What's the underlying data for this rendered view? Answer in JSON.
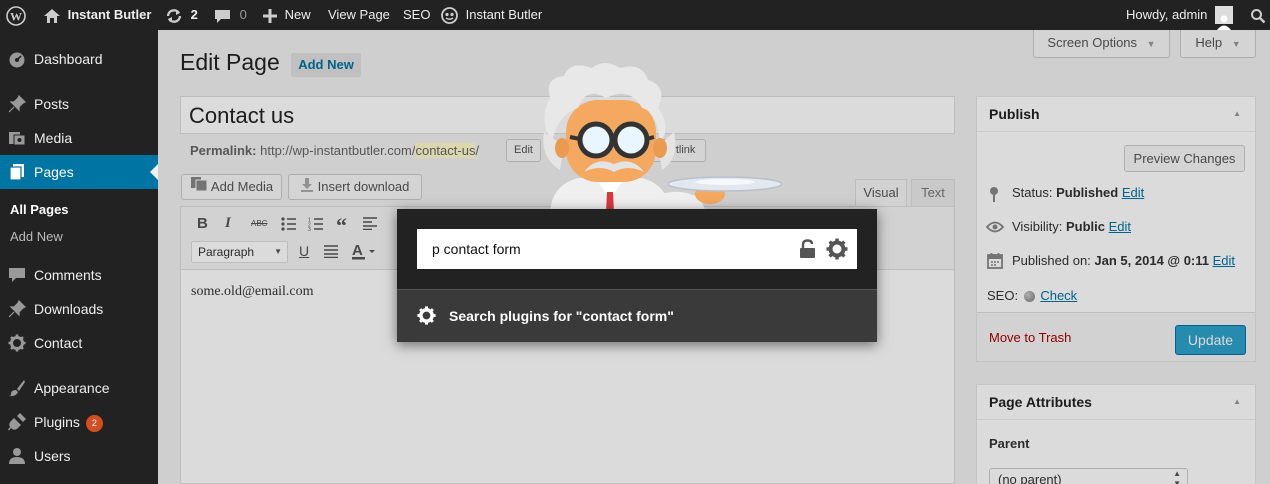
{
  "admin_bar": {
    "site_name": "Instant Butler",
    "updates_count": "2",
    "comments_count": "0",
    "new_label": "New",
    "view_page_label": "View Page",
    "seo_label": "SEO",
    "butler_label": "Instant Butler",
    "greeting": "Howdy, admin"
  },
  "sidebar": {
    "items": [
      {
        "label": "Dashboard",
        "icon": "dashboard-icon"
      },
      {
        "label": "Posts",
        "icon": "pin-icon"
      },
      {
        "label": "Media",
        "icon": "media-icon"
      },
      {
        "label": "Pages",
        "icon": "pages-icon"
      },
      {
        "label": "Comments",
        "icon": "comment-icon"
      },
      {
        "label": "Downloads",
        "icon": "pin-icon"
      },
      {
        "label": "Contact",
        "icon": "gear-icon"
      },
      {
        "label": "Appearance",
        "icon": "brush-icon"
      },
      {
        "label": "Plugins",
        "icon": "plug-icon",
        "badge": "2"
      },
      {
        "label": "Users",
        "icon": "user-icon"
      }
    ],
    "submenu": [
      "All Pages",
      "Add New"
    ]
  },
  "header": {
    "title": "Edit Page",
    "add_new": "Add New",
    "screen_options": "Screen Options",
    "help": "Help"
  },
  "editor": {
    "post_title": "Contact us",
    "permalink_label": "Permalink:",
    "permalink_base": "http://wp-instantbutler.com/",
    "permalink_slug": "contact-us",
    "permalink_trail": "/",
    "edit_label": "Edit",
    "shortlink_label": "Shortlink",
    "add_media": "Add Media",
    "insert_download": "Insert download",
    "tab_visual": "Visual",
    "tab_text": "Text",
    "format_select": "Paragraph",
    "content": "some.old@email.com"
  },
  "publish_box": {
    "title": "Publish",
    "preview": "Preview Changes",
    "status_label": "Status:",
    "status_value": "Published",
    "status_edit": "Edit",
    "visibility_label": "Visibility:",
    "visibility_value": "Public",
    "visibility_edit": "Edit",
    "published_label": "Published on:",
    "published_value": "Jan 5, 2014 @ 0:11",
    "published_edit": "Edit",
    "seo_label": "SEO:",
    "seo_check": "Check",
    "trash": "Move to Trash",
    "update": "Update"
  },
  "attributes_box": {
    "title": "Page Attributes",
    "parent_label": "Parent",
    "parent_value": "(no parent)"
  },
  "butler": {
    "query": "p contact form",
    "result": "Search plugins for \"contact form\""
  },
  "colors": {
    "admin_bar": "#222222",
    "active_menu": "#0074a2",
    "badge": "#d54e21",
    "update_button": "#2ea2cc",
    "trash": "#a00000"
  }
}
